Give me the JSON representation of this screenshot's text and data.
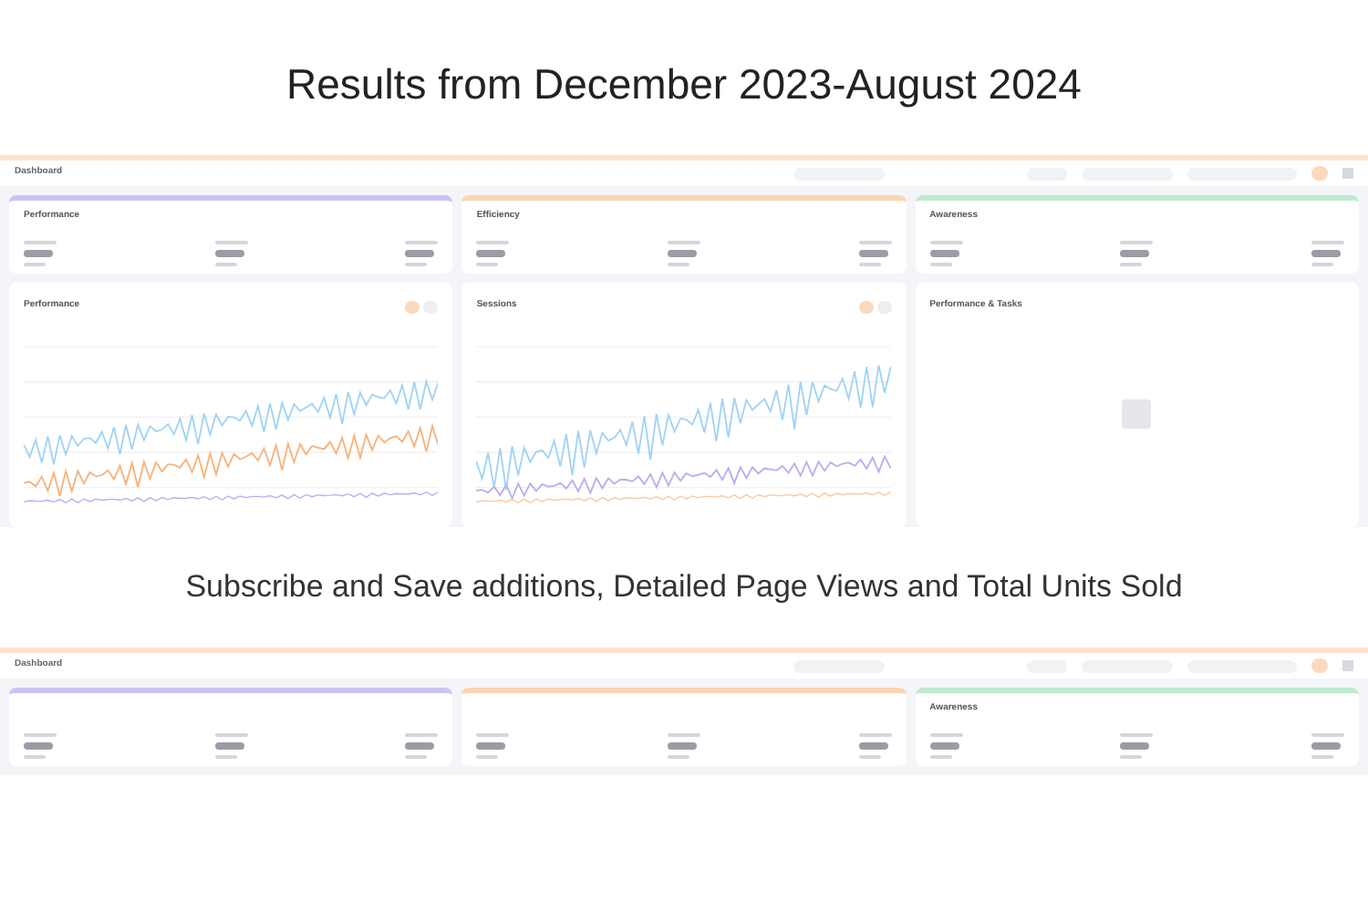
{
  "heading": "Results from December 2023-August 2024",
  "sections": [
    {
      "dashboard": {
        "title": "Dashboard",
        "cards": [
          {
            "title": "Performance",
            "color": "#c9c3f5"
          },
          {
            "title": "Efficiency",
            "color": "#fbd5b5"
          },
          {
            "title": "Awareness",
            "color": "#bfead0"
          }
        ],
        "panels": [
          {
            "title": "Performance",
            "kind": "chart"
          },
          {
            "title": "Sessions",
            "kind": "chart"
          },
          {
            "title": "Performance & Tasks",
            "kind": "empty"
          }
        ]
      }
    },
    {
      "caption": "Subscribe and Save additions, Detailed Page Views and Total Units Sold",
      "dashboard": {
        "title": "Dashboard",
        "cards": [
          {
            "color": "#c9c3f5"
          },
          {
            "color": "#fbd5b5"
          },
          {
            "title": "Awareness",
            "color": "#bfead0"
          }
        ]
      }
    }
  ]
}
